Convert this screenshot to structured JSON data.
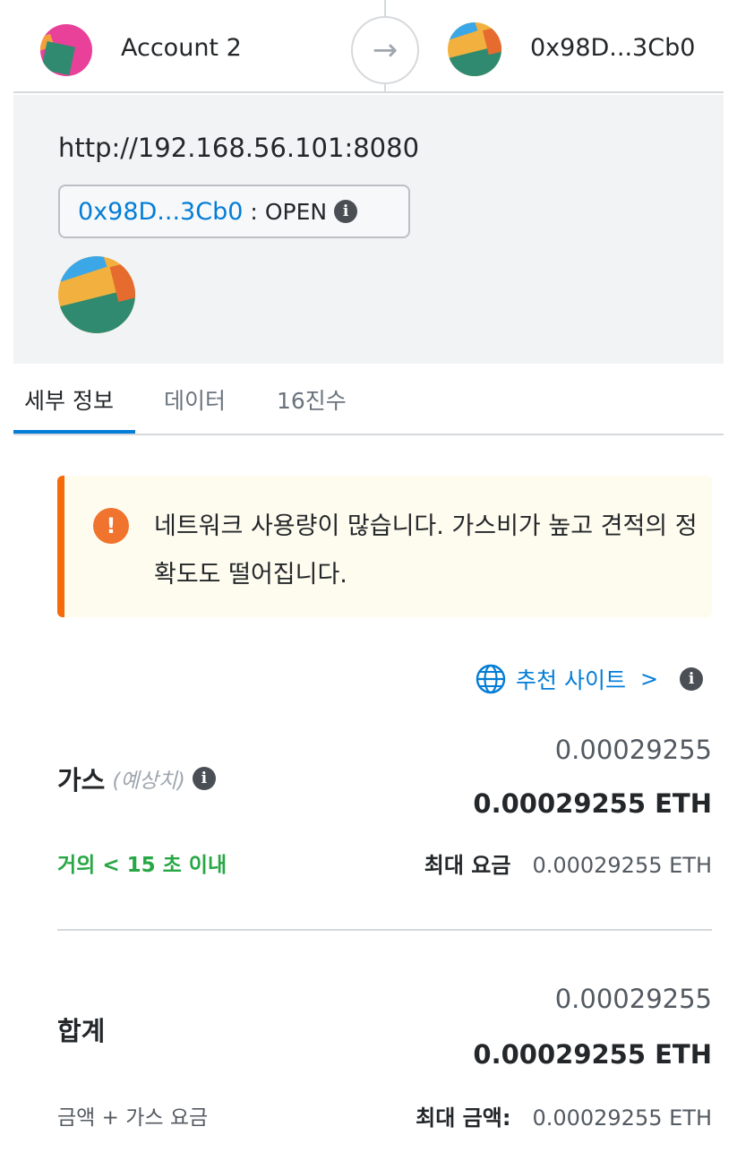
{
  "header": {
    "from_account": "Account 2",
    "arrow_icon": "arrow-right-icon",
    "to_address": "0x98D...3Cb0"
  },
  "origin": {
    "url": "http://192.168.56.101:8080",
    "account_address": "0x98D...3Cb0",
    "separator": ":",
    "state": "OPEN"
  },
  "tabs": [
    {
      "label": "세부 정보",
      "active": true
    },
    {
      "label": "데이터",
      "active": false
    },
    {
      "label": "16진수",
      "active": false
    }
  ],
  "warning": {
    "icon": "!",
    "text": "네트워크 사용량이 많습니다. 가스비가 높고 견적의 정확도도 떨어집니다."
  },
  "recommended": {
    "label": "추천 사이트",
    "chevron": ">"
  },
  "gas": {
    "label": "가스",
    "estimate_label": "(예상치)",
    "fiat_value": "0.00029255",
    "eth_value": "0.00029255 ETH",
    "time_estimate": "거의 < 15 초 이내",
    "max_fee_label": "최대 요금",
    "max_fee_value": "0.00029255 ETH"
  },
  "total": {
    "label": "합계",
    "fiat_value": "0.00029255",
    "eth_value": "0.00029255 ETH",
    "sub_label": "금액 + 가스 요금",
    "max_amount_label": "최대 금액:",
    "max_amount_value": "0.00029255 ETH"
  },
  "colors": {
    "accent": "#037dd6",
    "warning": "#f66a0a",
    "success": "#28a745",
    "panel_bg": "#f2f3f4"
  }
}
